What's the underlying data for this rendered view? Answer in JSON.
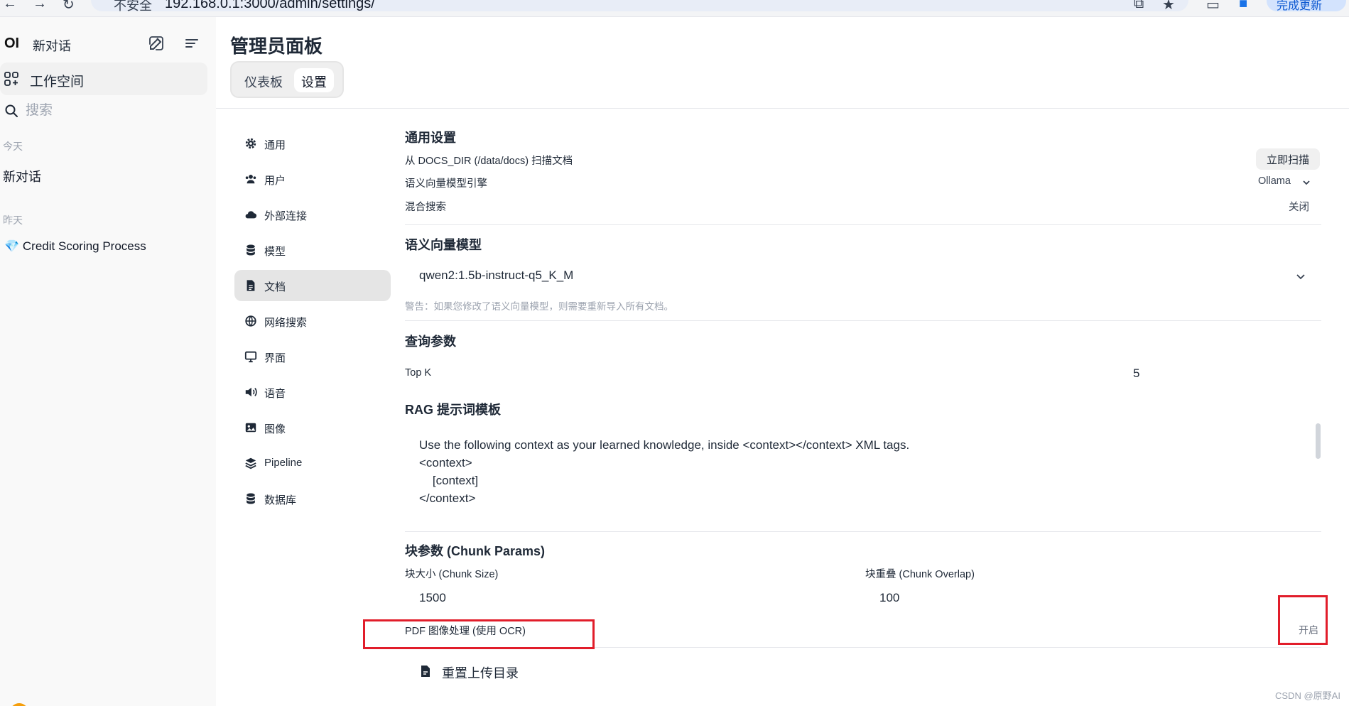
{
  "browser": {
    "security_label": "不安全",
    "url": "192.168.0.1:3000/admin/settings/",
    "update_label": "完成更新"
  },
  "sidebar": {
    "brand": "OI",
    "new_chat": "新对话",
    "workspace": "工作空间",
    "search_placeholder": "搜索",
    "groups": [
      {
        "label": "今天",
        "chats": [
          "新对话"
        ]
      },
      {
        "label": "昨天",
        "chats": [
          "Credit Scoring Process"
        ]
      }
    ],
    "chat_emoji": "💎"
  },
  "header": {
    "title": "管理员面板",
    "tabs": [
      {
        "label": "仪表板",
        "active": false
      },
      {
        "label": "设置",
        "active": true
      }
    ]
  },
  "settings_nav": [
    {
      "label": "通用",
      "icon": "gear-icon"
    },
    {
      "label": "用户",
      "icon": "users-icon"
    },
    {
      "label": "外部连接",
      "icon": "cloud-icon"
    },
    {
      "label": "模型",
      "icon": "database-icon"
    },
    {
      "label": "文档",
      "icon": "document-icon",
      "active": true
    },
    {
      "label": "网络搜索",
      "icon": "globe-icon"
    },
    {
      "label": "界面",
      "icon": "monitor-icon"
    },
    {
      "label": "语音",
      "icon": "speaker-icon"
    },
    {
      "label": "图像",
      "icon": "image-icon"
    },
    {
      "label": "Pipeline",
      "icon": "layers-icon"
    },
    {
      "label": "数据库",
      "icon": "database-icon"
    }
  ],
  "general": {
    "title": "通用设置",
    "scan_label": "从 DOCS_DIR (/data/docs) 扫描文档",
    "scan_button": "立即扫描",
    "engine_label": "语义向量模型引擎",
    "engine_value": "Ollama",
    "hybrid_label": "混合搜索",
    "hybrid_value": "关闭"
  },
  "embedding": {
    "title": "语义向量模型",
    "model": "qwen2:1.5b-instruct-q5_K_M",
    "warning": "警告：如果您修改了语义向量模型，则需要重新导入所有文档。"
  },
  "query": {
    "title": "查询参数",
    "topk_label": "Top K",
    "topk_value": "5"
  },
  "rag": {
    "title": "RAG 提示词模板",
    "template": "Use the following context as your learned knowledge, inside <context></context> XML tags.\n<context>\n    [context]\n</context>"
  },
  "chunk": {
    "title": "块参数 (Chunk Params)",
    "size_label": "块大小 (Chunk Size)",
    "size_value": "1500",
    "overlap_label": "块重叠 (Chunk Overlap)",
    "overlap_value": "100",
    "ocr_label": "PDF 图像处理 (使用 OCR)",
    "ocr_value": "开启"
  },
  "reset_label": "重置上传目录",
  "watermark": "CSDN @原野AI",
  "colors": {
    "annotation": "#e11d2a",
    "active_nav": "#e5e5e5"
  }
}
